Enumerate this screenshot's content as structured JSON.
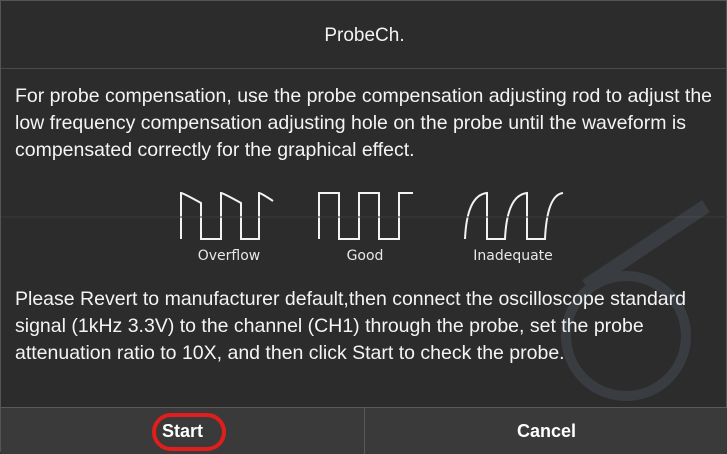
{
  "dialog": {
    "title": "ProbeCh.",
    "instructions": "For probe compensation, use the probe compensation adjusting rod to adjust the low frequency compensation adjusting hole on the probe until the waveform is compensated correctly for the graphical effect.",
    "waveforms": [
      {
        "label": "Overflow",
        "icon": "overflow-waveform-icon"
      },
      {
        "label": "Good",
        "icon": "good-waveform-icon"
      },
      {
        "label": "Inadequate",
        "icon": "inadequate-waveform-icon"
      }
    ],
    "steps": "Please Revert to manufacturer default,then connect the oscilloscope standard signal (1kHz 3.3V) to the channel (CH1) through the probe, set the probe attenuation ratio to 10X, and then click Start to check the probe."
  },
  "buttons": {
    "start_label": "Start",
    "cancel_label": "Cancel"
  },
  "colors": {
    "background": "#2c2c2c",
    "highlight_ring": "#e21d1d",
    "text": "#f4f4f4"
  }
}
